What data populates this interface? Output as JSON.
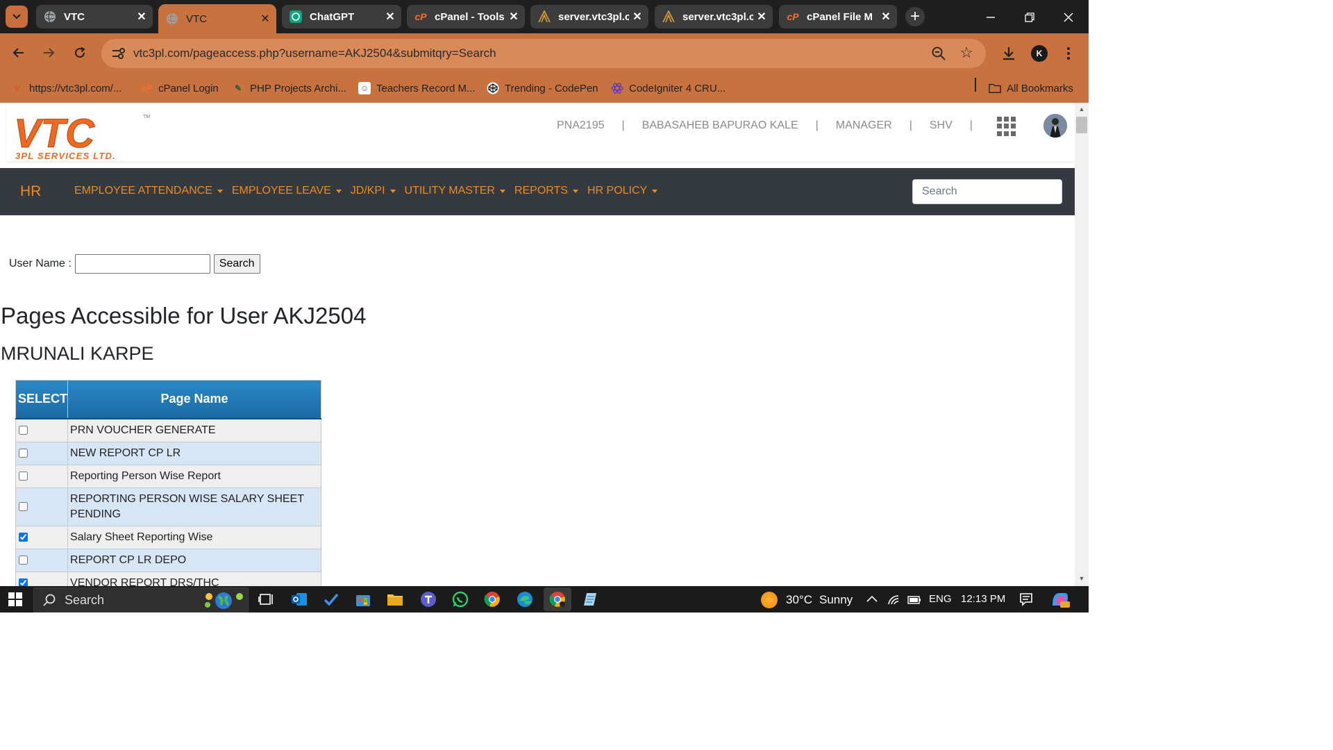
{
  "browser": {
    "tabs": [
      {
        "title": "VTC",
        "active": false,
        "icon": "globe-icon"
      },
      {
        "title": "VTC",
        "active": true,
        "icon": "globe-icon"
      },
      {
        "title": "ChatGPT",
        "active": false,
        "icon": "chatgpt-icon"
      },
      {
        "title": "cPanel - Tools",
        "active": false,
        "icon": "cpanel-icon"
      },
      {
        "title": "server.vtc3pl.c",
        "active": false,
        "icon": "server-icon"
      },
      {
        "title": "server.vtc3pl.c",
        "active": false,
        "icon": "server-icon"
      },
      {
        "title": "cPanel File M",
        "active": false,
        "icon": "cpanel-icon"
      }
    ],
    "url": "vtc3pl.com/pageaccess.php?username=AKJ2504&submitqry=Search",
    "profile_initial": "K",
    "bookmarks": [
      {
        "label": "https://vtc3pl.com/...",
        "icon": "vtc-icon"
      },
      {
        "label": "cPanel Login",
        "icon": "cpanel-icon"
      },
      {
        "label": "PHP Projects Archi...",
        "icon": "php-icon"
      },
      {
        "label": "Teachers Record M...",
        "icon": "teachers-icon"
      },
      {
        "label": "Trending - CodePen",
        "icon": "codepen-icon"
      },
      {
        "label": "CodeIgniter 4 CRU...",
        "icon": "codeigniter-icon"
      }
    ],
    "all_bookmarks": "All Bookmarks",
    "accent": "#c8733f"
  },
  "site": {
    "logo_main": "VTC",
    "logo_sub": "3PL SERVICES LTD.",
    "logo_tm": "TM",
    "user_code": "PNA2195",
    "user_name": "BABASAHEB BAPURAO KALE",
    "user_role": "MANAGER",
    "user_branch": "SHV",
    "separator": "|",
    "nav": {
      "brand": "HR",
      "items": [
        "EMPLOYEE ATTENDANCE",
        "EMPLOYEE LEAVE",
        "JD/KPI",
        "UTILITY MASTER",
        "REPORTS",
        "HR POLICY"
      ],
      "search_placeholder": "Search",
      "accent": "#f08a1a",
      "background": "#343a40"
    },
    "form": {
      "label": "User Name :",
      "value": "",
      "button": "Search"
    },
    "heading": "Pages Accessible for User AKJ2504",
    "employee_name": "MRUNALI KARPE",
    "table": {
      "headers": [
        "SELECT",
        "Page Name"
      ],
      "rows": [
        {
          "page": "PRN VOUCHER GENERATE",
          "checked": false
        },
        {
          "page": "NEW REPORT CP LR",
          "checked": false
        },
        {
          "page": "Reporting Person Wise Report",
          "checked": false
        },
        {
          "page": "REPORTING PERSON WISE SALARY SHEET PENDING",
          "checked": false
        },
        {
          "page": "Salary Sheet Reporting Wise",
          "checked": true
        },
        {
          "page": "REPORT CP LR DEPO",
          "checked": false
        },
        {
          "page": "VENDOR REPORT DRS/THC",
          "checked": true
        }
      ]
    }
  },
  "taskbar": {
    "search": "Search",
    "weather_temp": "30°C",
    "weather_desc": "Sunny",
    "lang": "ENG",
    "time": "12:13 PM"
  }
}
